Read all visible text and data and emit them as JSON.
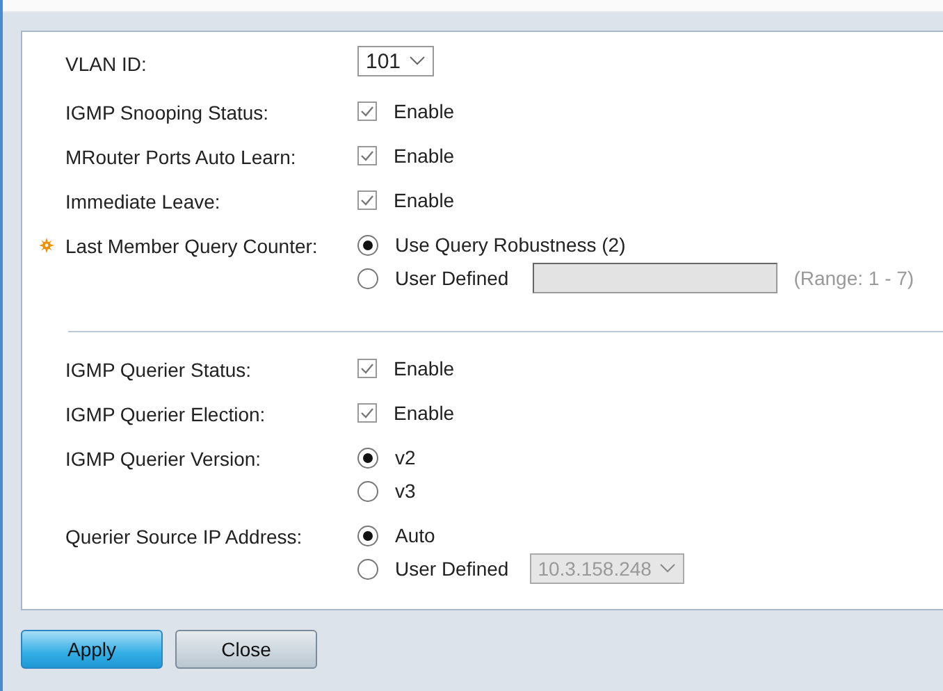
{
  "sections": [
    {
      "fields": [
        {
          "kind": "select",
          "label": "VLAN ID:",
          "value": "101"
        },
        {
          "kind": "checkbox",
          "label": "IGMP Snooping Status:",
          "option": "Enable",
          "checked": true
        },
        {
          "kind": "checkbox",
          "label": "MRouter Ports Auto Learn:",
          "option": "Enable",
          "checked": true
        },
        {
          "kind": "checkbox",
          "label": "Immediate Leave:",
          "option": "Enable",
          "checked": true
        },
        {
          "kind": "radio",
          "label": "Last Member Query Counter:",
          "required": true,
          "options": [
            {
              "label": "Use Query Robustness (2)",
              "selected": true
            },
            {
              "label": "User Defined",
              "selected": false,
              "extra": {
                "kind": "text",
                "disabled": true,
                "hint": "(Range: 1 - 7)"
              }
            }
          ]
        }
      ]
    },
    {
      "fields": [
        {
          "kind": "checkbox",
          "label": "IGMP Querier Status:",
          "option": "Enable",
          "checked": true
        },
        {
          "kind": "checkbox",
          "label": "IGMP Querier Election:",
          "option": "Enable",
          "checked": true
        },
        {
          "kind": "radio",
          "label": "IGMP Querier Version:",
          "options": [
            {
              "label": "v2",
              "selected": true
            },
            {
              "label": "v3",
              "selected": false
            }
          ]
        },
        {
          "kind": "radio",
          "label": "Querier Source IP Address:",
          "options": [
            {
              "label": "Auto",
              "selected": true
            },
            {
              "label": "User Defined",
              "selected": false,
              "extra": {
                "kind": "select",
                "disabled": true,
                "value": "10.3.158.248"
              }
            }
          ]
        }
      ]
    }
  ],
  "buttons": [
    {
      "label": "Apply",
      "primary": true
    },
    {
      "label": "Close",
      "primary": false
    }
  ]
}
